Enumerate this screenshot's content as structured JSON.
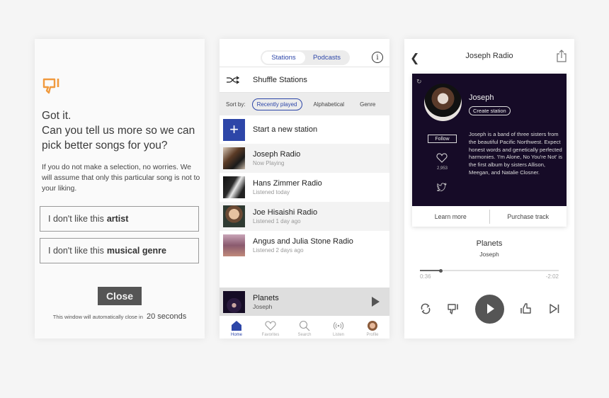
{
  "feedback": {
    "icon": "thumbs-down-icon",
    "accent_color": "#f09a3e",
    "title_line1": "Got it.",
    "title_line2": "Can you tell us more so we can",
    "title_line3": "pick better songs for you?",
    "description": "If you do not make a selection, no worries. We will assume that only this particular song is not to your liking.",
    "options": [
      {
        "prefix": "I don't like this",
        "bold": "artist"
      },
      {
        "prefix": "I don't like this",
        "bold": "musical genre"
      }
    ],
    "close_label": "Close",
    "countdown_text": "This window will automatically close in",
    "countdown_value": "20 seconds"
  },
  "stations": {
    "tabs": [
      {
        "label": "Stations",
        "active": true
      },
      {
        "label": "Podcasts",
        "active": false
      }
    ],
    "info_icon": "i",
    "shuffle_label": "Shuffle Stations",
    "sort_label": "Sort by:",
    "sort_options": [
      {
        "label": "Recently played",
        "active": true
      },
      {
        "label": "Alphabetical",
        "active": false
      },
      {
        "label": "Genre",
        "active": false
      }
    ],
    "new_station_label": "Start a new station",
    "new_station_icon": "+",
    "items": [
      {
        "name": "Joseph Radio",
        "sub": "Now Playing"
      },
      {
        "name": "Hans Zimmer Radio",
        "sub": "Listened today"
      },
      {
        "name": "Joe Hisaishi Radio",
        "sub": "Listened 1 day ago"
      },
      {
        "name": "Angus and Julia Stone Radio",
        "sub": "Listened 2 days ago"
      }
    ],
    "mini_player": {
      "title": "Planets",
      "artist": "Joseph"
    },
    "bottom_nav": [
      {
        "label": "Home",
        "icon": "home-icon",
        "active": true
      },
      {
        "label": "Favorites",
        "icon": "heart-icon",
        "active": false
      },
      {
        "label": "Search",
        "icon": "search-icon",
        "active": false
      },
      {
        "label": "Listen",
        "icon": "broadcast-icon",
        "active": false
      },
      {
        "label": "Profile",
        "icon": "profile-avatar",
        "active": false
      }
    ],
    "brand_color": "#2d46a8"
  },
  "player": {
    "title": "Joseph Radio",
    "artist": {
      "name": "Joseph",
      "create_station_label": "Create station",
      "follow_label": "Follow",
      "likes": "2,953",
      "bio": "Joseph is a band of three sisters from the beautiful Pacific Northwest. Expect honest words and genetically perfected harmonies.  'I'm Alone, No You're Not' is the first album by sisters Allison, Meegan, and Natalie Closner."
    },
    "learn_more_label": "Learn more",
    "purchase_label": "Purchase track",
    "track_title": "Planets",
    "track_artist": "Joseph",
    "elapsed": "0:36",
    "remaining": "-2:02",
    "progress_fraction": 0.15,
    "card_bg_color": "#160b27"
  }
}
